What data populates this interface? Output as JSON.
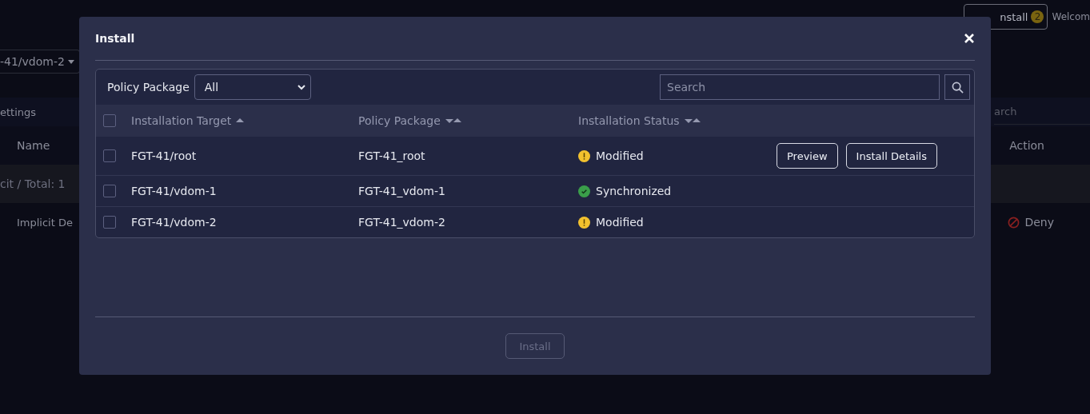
{
  "background": {
    "install_button": {
      "label": "nstall",
      "badge": "2"
    },
    "welcome": "Welcom",
    "vdom_dropdown": "-41/vdom-2",
    "tab": "ettings",
    "search_placeholder": "arch",
    "columns": [
      "Name",
      "Action"
    ],
    "group_row": "cit / Total: 1",
    "row": {
      "name": "Implicit De",
      "action": "Deny"
    }
  },
  "dialog": {
    "title": "Install",
    "filter": {
      "label": "Policy Package",
      "value": "All"
    },
    "search": {
      "placeholder": "Search"
    },
    "table": {
      "columns": [
        {
          "label": "Installation Target",
          "sorted": true
        },
        {
          "label": "Policy Package",
          "sorted": false
        },
        {
          "label": "Installation Status",
          "sorted": false
        }
      ],
      "select_all": {
        "checked": false
      },
      "rows": [
        {
          "checked": false,
          "target": "FGT-41/root",
          "package": "FGT-41_root",
          "status": {
            "kind": "warning",
            "label": "Modified"
          },
          "actions": [
            "Preview",
            "Install Details"
          ]
        },
        {
          "checked": false,
          "target": "FGT-41/vdom-1",
          "package": "FGT-41_vdom-1",
          "status": {
            "kind": "ok",
            "label": "Synchronized"
          }
        },
        {
          "checked": false,
          "target": "FGT-41/vdom-2",
          "package": "FGT-41_vdom-2",
          "status": {
            "kind": "warning",
            "label": "Modified"
          }
        }
      ]
    },
    "footer_button": {
      "label": "Install",
      "disabled": true
    }
  }
}
